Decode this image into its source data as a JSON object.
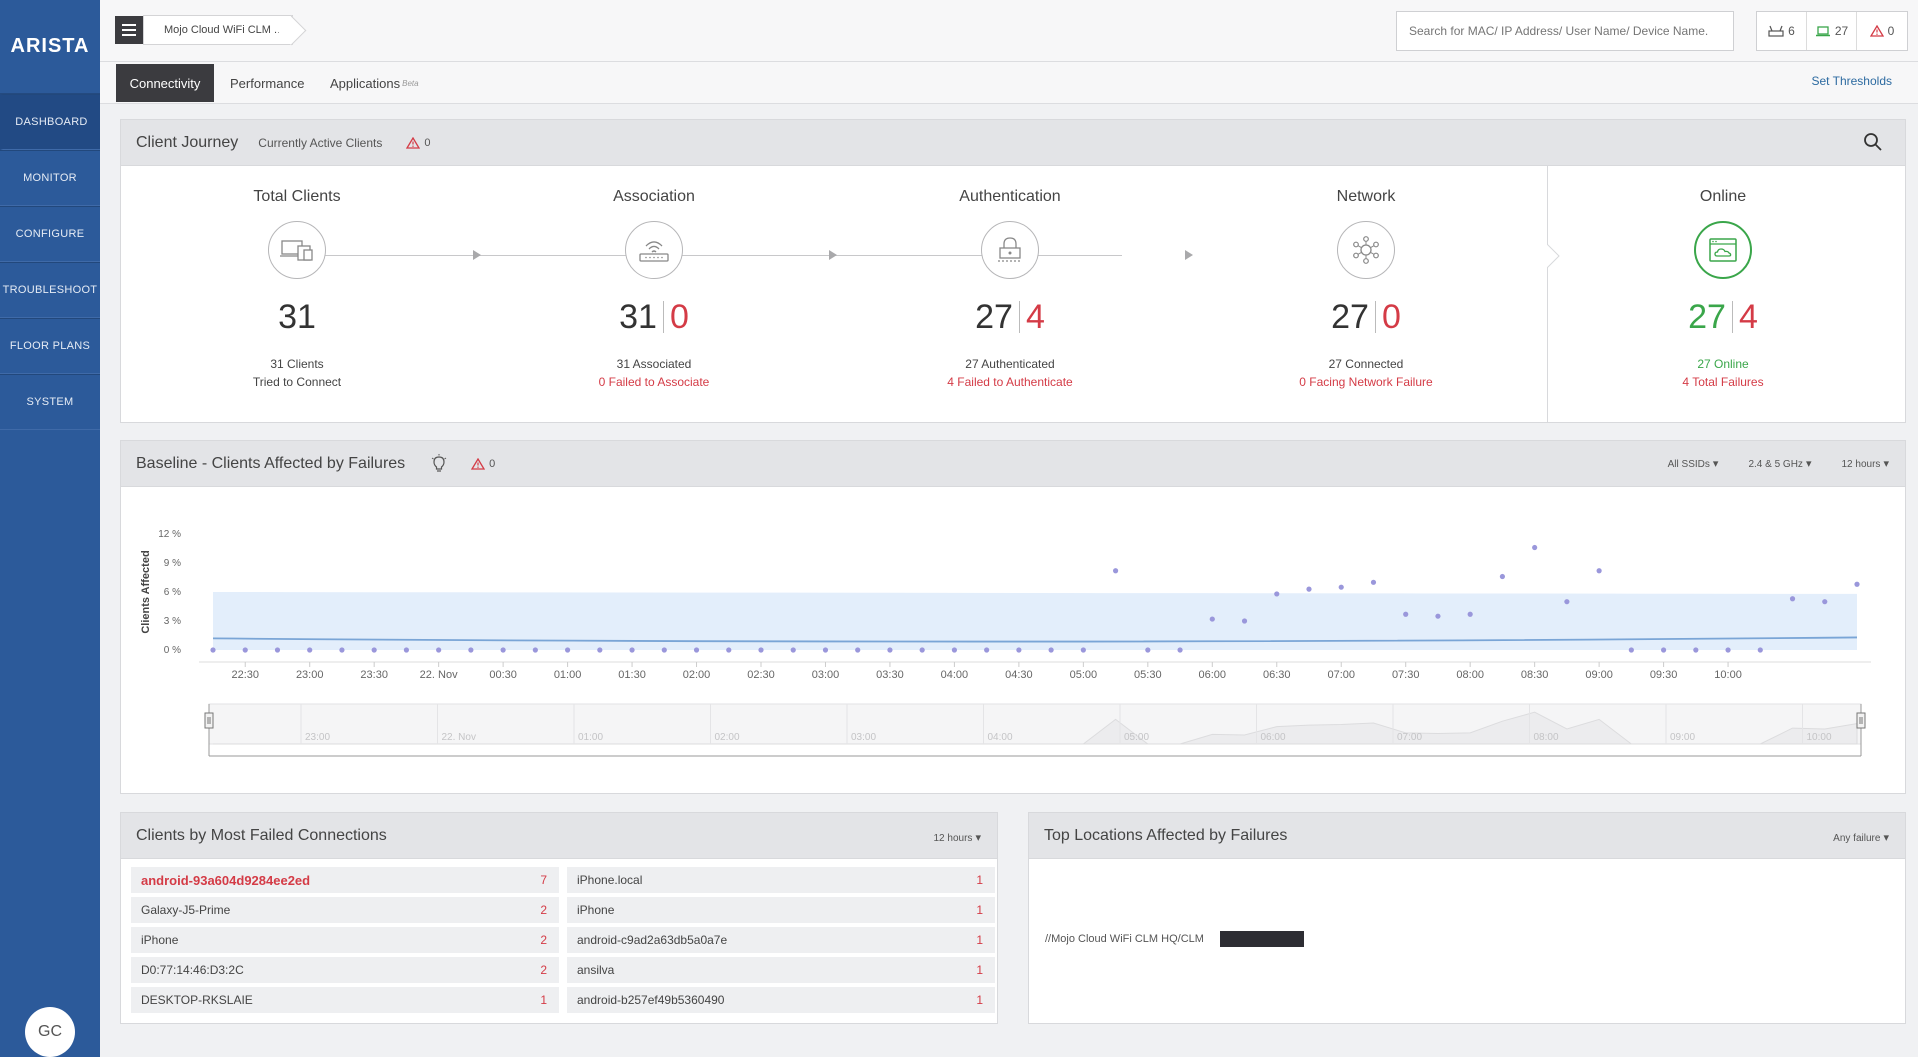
{
  "brand": "ARISTA",
  "sidebar": {
    "items": [
      {
        "label": "DASHBOARD"
      },
      {
        "label": "MONITOR"
      },
      {
        "label": "CONFIGURE"
      },
      {
        "label": "TROUBLESHOOT"
      },
      {
        "label": "FLOOR PLANS"
      },
      {
        "label": "SYSTEM"
      }
    ],
    "avatar": "GC"
  },
  "topbar": {
    "location": "Mojo Cloud WiFi CLM ...",
    "search_placeholder": "Search for MAC/ IP Address/ User Name/ Device Name.",
    "counts": {
      "aps": "6",
      "clients": "27",
      "alerts": "0"
    }
  },
  "tabs": {
    "connectivity": "Connectivity",
    "performance": "Performance",
    "applications": "Applications",
    "applications_badge": "Beta",
    "set_thresholds": "Set Thresholds"
  },
  "journey": {
    "title": "Client Journey",
    "subtitle": "Currently Active Clients",
    "alert_count": "0",
    "stages": [
      {
        "title": "Total Clients",
        "num": "31",
        "cap1": "31 Clients",
        "cap2": "Tried to Connect"
      },
      {
        "title": "Association",
        "num": "31",
        "fail": "0",
        "cap1": "31 Associated",
        "cap2": "0 Failed to Associate"
      },
      {
        "title": "Authentication",
        "num": "27",
        "fail": "4",
        "cap1": "27 Authenticated",
        "cap2": "4 Failed to Authenticate"
      },
      {
        "title": "Network",
        "num": "27",
        "fail": "0",
        "cap1": "27 Connected",
        "cap2": "0 Facing Network Failure"
      },
      {
        "title": "Online",
        "num": "27",
        "fail": "4",
        "cap1": "27 Online",
        "cap2": "4 Total Failures"
      }
    ]
  },
  "baseline": {
    "title": "Baseline - Clients Affected by Failures",
    "alert_count": "0",
    "filters": {
      "ssid": "All SSIDs",
      "band": "2.4 & 5 GHz",
      "range": "12 hours"
    }
  },
  "chart_data": {
    "type": "scatter",
    "ylabel": "Clients Affected",
    "yticks": [
      "12 %",
      "9 %",
      "6 %",
      "3 %",
      "0 %"
    ],
    "ylim": [
      0,
      12
    ],
    "x_labels": [
      "22:30",
      "23:00",
      "23:30",
      "22. Nov",
      "00:30",
      "01:00",
      "01:30",
      "02:00",
      "02:30",
      "03:00",
      "03:30",
      "04:00",
      "04:30",
      "05:00",
      "05:30",
      "06:00",
      "06:30",
      "07:00",
      "07:30",
      "08:00",
      "08:30",
      "09:00",
      "09:30",
      "10:00"
    ],
    "x_start": "22:30",
    "x_step_minutes": 15,
    "points": [
      0,
      0,
      0,
      0,
      0,
      0,
      0,
      0,
      0,
      0,
      0,
      0,
      0,
      0,
      0,
      0,
      0,
      0,
      0,
      0,
      0,
      0,
      0,
      0,
      0,
      0,
      0,
      0,
      8.2,
      0,
      0,
      3.2,
      3,
      5.8,
      6.3,
      6.5,
      7,
      3.7,
      3.5,
      3.7,
      7.6,
      10.6,
      5,
      8.2,
      0,
      0,
      0,
      0,
      0,
      5.3,
      5,
      6.8
    ],
    "band": {
      "lower": 0,
      "upper_start": 6,
      "upper_end": 5.8
    },
    "baseline": {
      "start": 1.2,
      "mid": 0.9,
      "end": 1.3
    },
    "navigator_labels": [
      "23:00",
      "22. Nov",
      "01:00",
      "02:00",
      "03:00",
      "04:00",
      "05:00",
      "06:00",
      "07:00",
      "08:00",
      "09:00",
      "10:00"
    ],
    "colors": {
      "point": "#9a97db",
      "band": "#e3eefb",
      "line": "#7aa5d6"
    }
  },
  "clients_card": {
    "title": "Clients by Most Failed Connections",
    "range": "12 hours",
    "left": [
      {
        "name": "android-93a604d9284ee2ed",
        "count": "7"
      },
      {
        "name": "Galaxy-J5-Prime",
        "count": "2"
      },
      {
        "name": "iPhone",
        "count": "2"
      },
      {
        "name": "D0:77:14:46:D3:2C",
        "count": "2"
      },
      {
        "name": "DESKTOP-RKSLAIE",
        "count": "1"
      }
    ],
    "right": [
      {
        "name": "iPhone.local",
        "count": "1"
      },
      {
        "name": "iPhone",
        "count": "1"
      },
      {
        "name": "android-c9ad2a63db5a0a7e",
        "count": "1"
      },
      {
        "name": "ansilva",
        "count": "1"
      },
      {
        "name": "android-b257ef49b5360490",
        "count": "1"
      }
    ]
  },
  "locations_card": {
    "title": "Top Locations Affected by Failures",
    "filter": "Any failure",
    "rows": [
      {
        "path": "//Mojo Cloud WiFi CLM HQ/CLM",
        "value": 1
      }
    ]
  }
}
